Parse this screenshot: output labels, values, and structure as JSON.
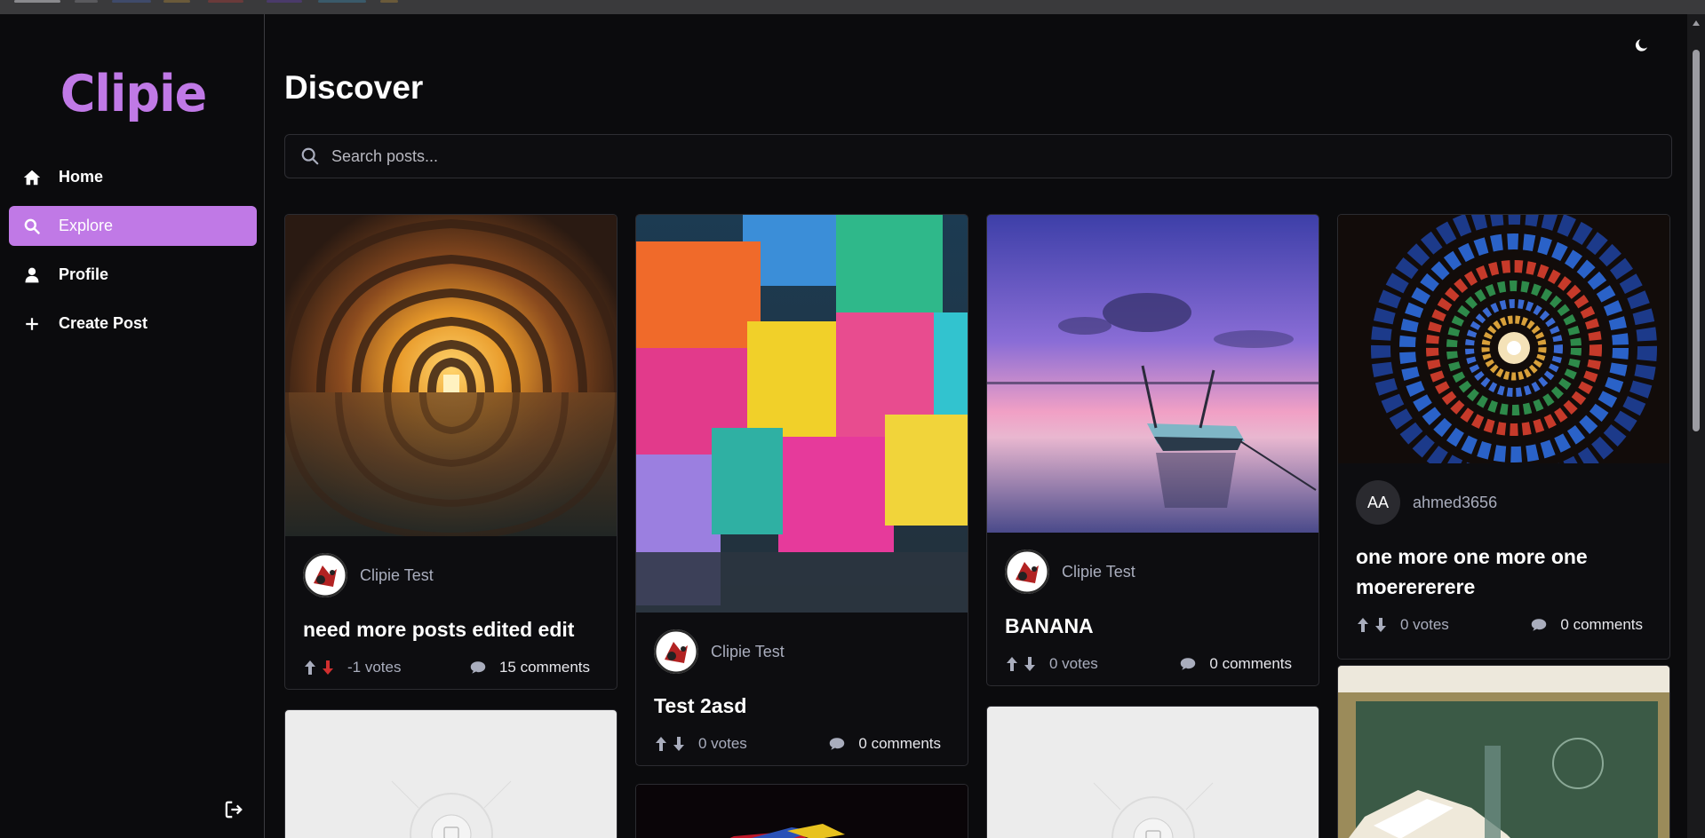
{
  "app": {
    "logo_text": "Clipie",
    "accent_color": "#c079e6"
  },
  "sidebar": {
    "items": [
      {
        "label": "Home",
        "icon": "home-icon",
        "active": false
      },
      {
        "label": "Explore",
        "icon": "search-icon",
        "active": true
      },
      {
        "label": "Profile",
        "icon": "user-icon",
        "active": false
      },
      {
        "label": "Create Post",
        "icon": "plus-icon",
        "active": false
      }
    ],
    "logout_icon": "logout-icon"
  },
  "header": {
    "title": "Discover",
    "theme_toggle_icon": "moon-icon"
  },
  "search": {
    "placeholder": "Search posts..."
  },
  "posts": [
    {
      "author": "Clipie Test",
      "title": "need more posts edited edit",
      "votes": "-1 votes",
      "comments": "15 comments",
      "vote_state": "down",
      "image": "arched corridor reflection"
    },
    {
      "author": "Clipie Test",
      "title": "Test 2asd",
      "votes": "0 votes",
      "comments": "0 comments",
      "vote_state": "none",
      "image": "colorful chalk cubes"
    },
    {
      "author": "Clipie Test",
      "title": "BANANA",
      "votes": "0 votes",
      "comments": "0 comments",
      "vote_state": "none",
      "image": "boat at sunset lake"
    },
    {
      "author": "ahmed3656",
      "author_initials": "AA",
      "title": "one more one more one moerererere",
      "votes": "0 votes",
      "comments": "0 comments",
      "vote_state": "none",
      "image": "stained glass spiral ceiling"
    }
  ]
}
